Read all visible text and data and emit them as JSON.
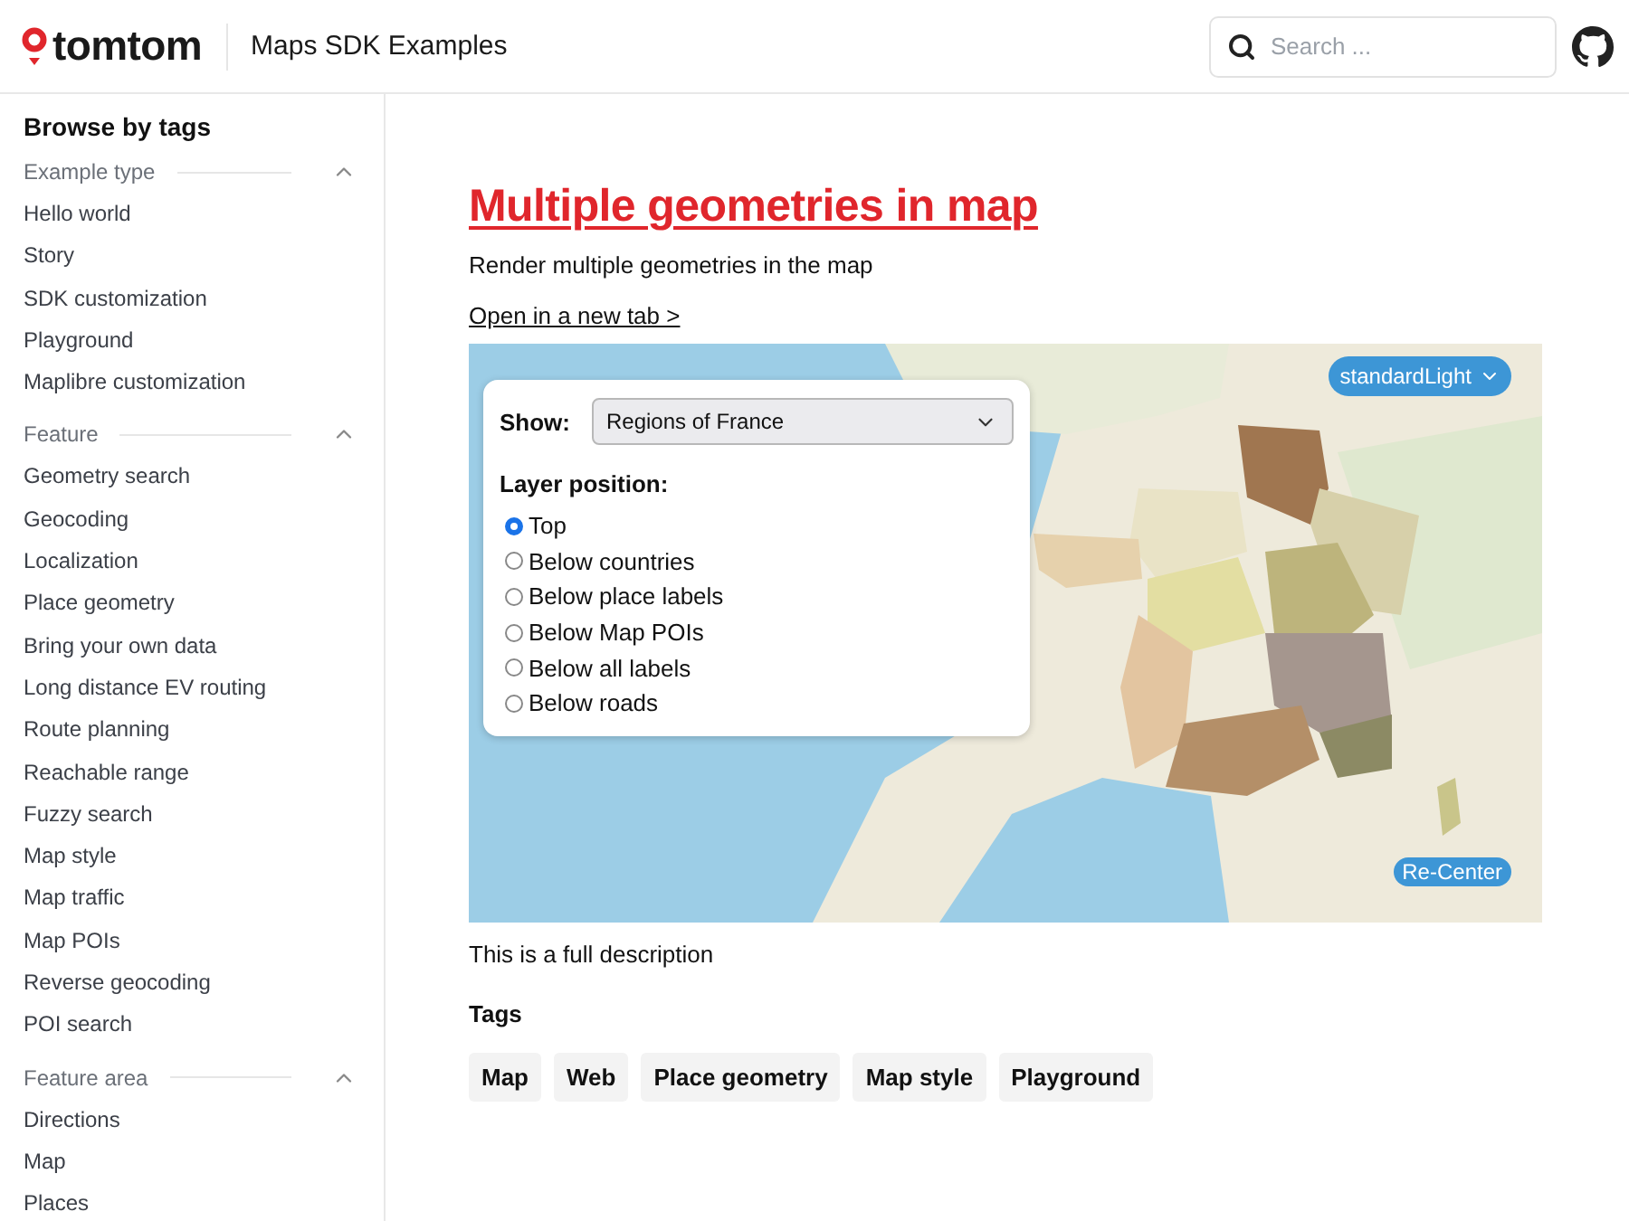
{
  "header": {
    "logo": "tomtom",
    "title": "Maps SDK Examples",
    "search": {
      "placeholder": "Search ..."
    }
  },
  "sidebar": {
    "title": "Browse by tags",
    "sections": [
      {
        "heading": "Example type",
        "expanded": true,
        "items": [
          "Hello world",
          "Story",
          "SDK customization",
          "Playground",
          "Maplibre customization"
        ]
      },
      {
        "heading": "Feature",
        "expanded": true,
        "items": [
          "Geometry search",
          "Geocoding",
          "Localization",
          "Place geometry",
          "Bring your own data",
          "Long distance EV routing",
          "Route planning",
          "Reachable range",
          "Fuzzy search",
          "Map style",
          "Map traffic",
          "Map POIs",
          "Reverse geocoding",
          "POI search"
        ]
      },
      {
        "heading": "Feature area",
        "expanded": true,
        "items": [
          "Directions",
          "Map",
          "Places"
        ]
      }
    ]
  },
  "page": {
    "title": "Multiple geometries in map",
    "subtitle": "Render multiple geometries in the map",
    "open_link": "Open in a new tab >",
    "map": {
      "kind": "picture",
      "style_button": "standardLight",
      "recenter_button": "Re-Center",
      "panel": {
        "show_label": "Show:",
        "show_value": "Regions of France",
        "layer_label": "Layer position:",
        "options": [
          {
            "label": "Top",
            "selected": true
          },
          {
            "label": "Below countries",
            "selected": false
          },
          {
            "label": "Below place labels",
            "selected": false
          },
          {
            "label": "Below Map POIs",
            "selected": false
          },
          {
            "label": "Below all labels",
            "selected": false
          },
          {
            "label": "Below roads",
            "selected": false
          }
        ]
      }
    },
    "description": "This is a full description",
    "tags_heading": "Tags",
    "tags": [
      "Map",
      "Web",
      "Place geometry",
      "Map style",
      "Playground"
    ]
  }
}
